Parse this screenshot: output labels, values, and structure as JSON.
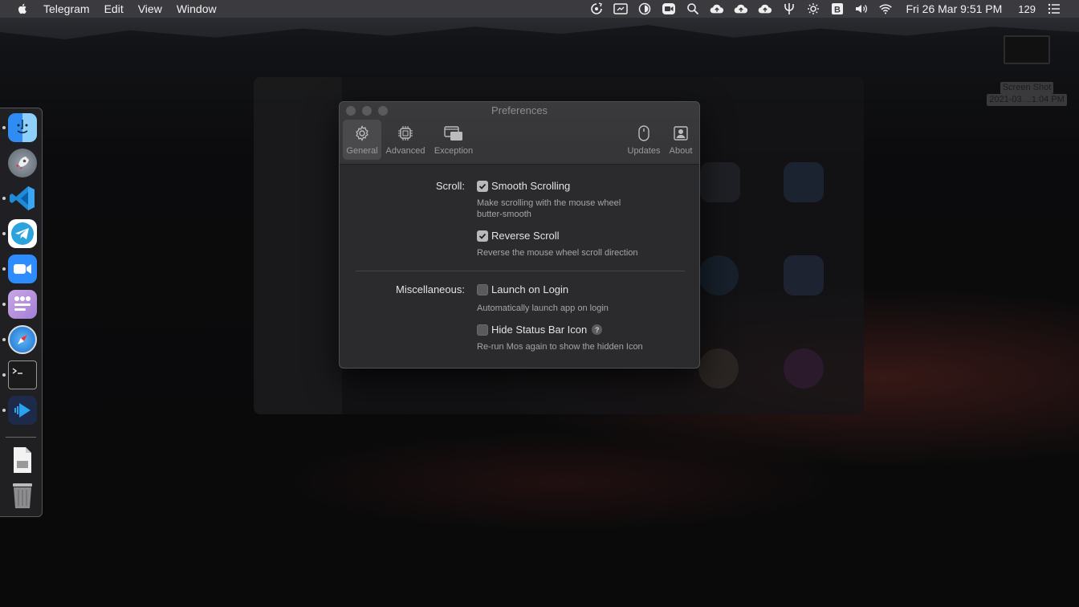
{
  "menubar": {
    "app_name": "Telegram",
    "menus": [
      "Edit",
      "View",
      "Window"
    ],
    "clock": "Fri 26 Mar  9:51 PM",
    "badge": "129",
    "status_icons": [
      "sync-icon",
      "screen-capture-icon",
      "circle-icon",
      "zoom-video-icon",
      "search-icon",
      "cloud-upload-icon",
      "cloud-upload-icon",
      "cloud-upload-icon",
      "fork-icon",
      "brightness-icon",
      "bitwarden-icon",
      "volume-icon",
      "wifi-icon",
      "list-icon"
    ]
  },
  "desktop": {
    "file_label_line1": "Screen Shot",
    "file_label_line2": "2021-03....1.04 PM"
  },
  "dock": {
    "apps": [
      "Finder",
      "Launchpad",
      "Visual Studio Code",
      "Telegram",
      "Zoom",
      "Mos",
      "Safari",
      "Terminal",
      "Infuse",
      "Document",
      "Trash"
    ]
  },
  "prefs": {
    "title": "Preferences",
    "toolbar": {
      "general": "General",
      "advanced": "Advanced",
      "exception": "Exception",
      "updates": "Updates",
      "about": "About"
    },
    "scroll": {
      "label": "Scroll:",
      "smooth": {
        "label": "Smooth Scrolling",
        "checked": true,
        "desc_line1": "Make scrolling with the mouse wheel",
        "desc_line2": "butter-smooth"
      },
      "reverse": {
        "label": "Reverse Scroll",
        "checked": true,
        "desc": "Reverse the mouse wheel scroll direction"
      }
    },
    "misc": {
      "label": "Miscellaneous:",
      "launch": {
        "label": "Launch on Login",
        "checked": false,
        "desc": "Automatically launch app on login"
      },
      "hide": {
        "label": "Hide Status Bar Icon",
        "checked": false,
        "help": "?",
        "desc": "Re-run Mos again to show the hidden Icon"
      }
    }
  }
}
